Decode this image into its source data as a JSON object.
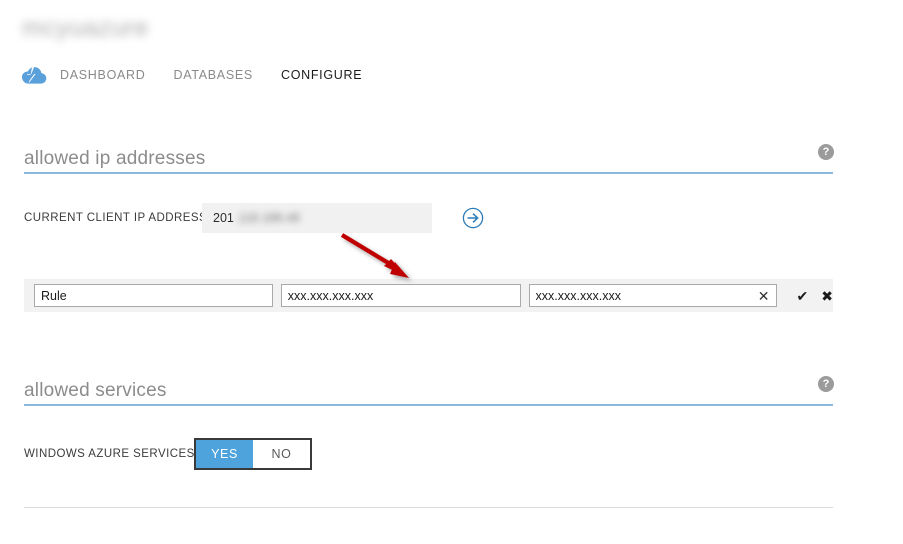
{
  "header": {
    "title": "mcyuazure",
    "brand_icon": "cloud-lightning-icon",
    "tabs": [
      {
        "label": "DASHBOARD",
        "active": false
      },
      {
        "label": "DATABASES",
        "active": false
      },
      {
        "label": "CONFIGURE",
        "active": true
      }
    ]
  },
  "sections": {
    "allowed_ip": {
      "title": "allowed ip addresses",
      "help_glyph": "?",
      "current_ip": {
        "label": "CURRENT CLIENT IP ADDRESS",
        "value_visible": "201",
        "value_masked": ".118.188.48",
        "add_button_icon": "circle-arrow-right-icon"
      },
      "rule_editor": {
        "name_placeholder": "Rule",
        "name_value": "",
        "start_ip_value": "xxx.xxx.xxx.xxx",
        "end_ip_value": "xxx.xxx.xxx.xxx",
        "clear_glyph": "✕",
        "confirm_glyph": "✔",
        "cancel_glyph": "✖"
      }
    },
    "allowed_services": {
      "title": "allowed services",
      "help_glyph": "?",
      "windows_azure_services": {
        "label": "WINDOWS AZURE SERVICES",
        "options": [
          "YES",
          "NO"
        ],
        "selected": "YES"
      }
    }
  },
  "colors": {
    "accent_blue": "#4fa3dd",
    "rule_blue": "#8cb8de",
    "annotation_red": "#c00000",
    "row_gray": "#f2f2f2"
  },
  "annotation": {
    "arrow_name": "red-pointer-arrow",
    "color": "#c00000"
  }
}
